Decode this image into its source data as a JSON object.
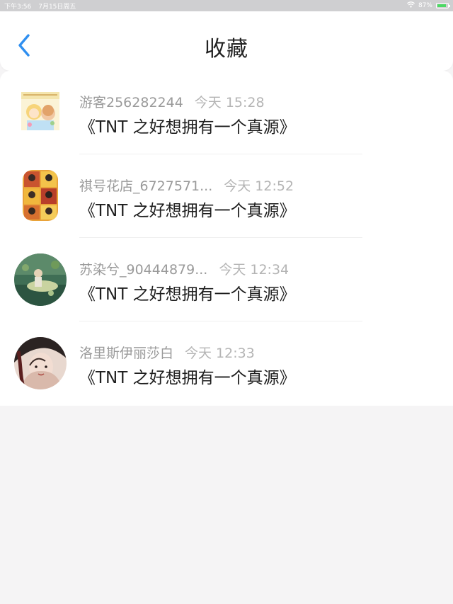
{
  "status_bar": {
    "time": "下午3:56",
    "date": "7月15日周五",
    "battery": "87%",
    "battery_level": 0.87
  },
  "header": {
    "title": "收藏",
    "back_icon": "chevron-left-icon",
    "accent_color": "#2f8ff0"
  },
  "favorites": [
    {
      "user": "游客256282244",
      "time": "今天 15:28",
      "title": "《TNT 之好想拥有一个真源》"
    },
    {
      "user": "祺号花店_6727571...",
      "time": "今天 12:52",
      "title": "《TNT 之好想拥有一个真源》"
    },
    {
      "user": "苏染兮_90444879...",
      "time": "今天 12:34",
      "title": "《TNT 之好想拥有一个真源》"
    },
    {
      "user": "洛里斯伊丽莎白",
      "time": "今天 12:33",
      "title": "《TNT 之好想拥有一个真源》"
    }
  ]
}
